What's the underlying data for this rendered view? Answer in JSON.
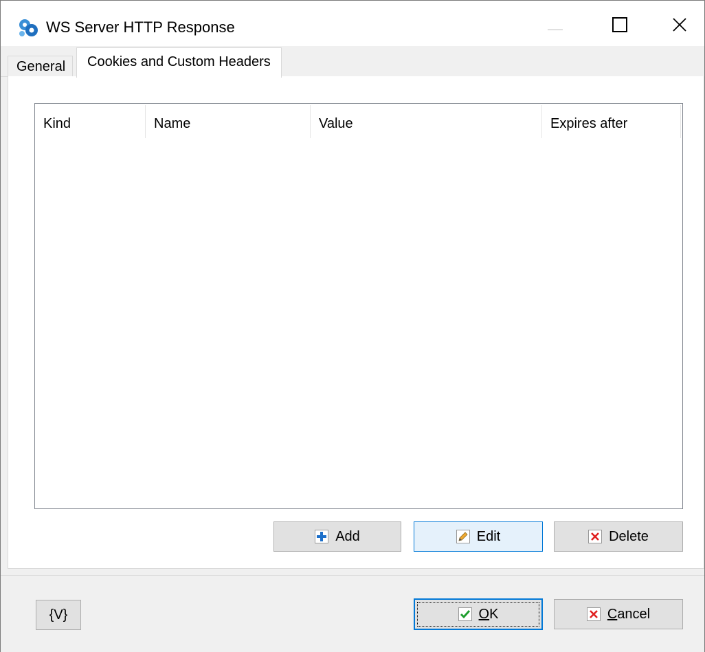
{
  "window": {
    "title": "WS Server HTTP Response",
    "icon": "gears-icon"
  },
  "tabs": [
    {
      "label": "General",
      "active": false
    },
    {
      "label": "Cookies and Custom Headers",
      "active": true
    }
  ],
  "list": {
    "columns": [
      "Kind",
      "Name",
      "Value",
      "Expires after"
    ],
    "rows": []
  },
  "actions": {
    "add_label": "Add",
    "edit_label": "Edit",
    "delete_label": "Delete"
  },
  "footer": {
    "vars_label": "{V}",
    "ok_first": "O",
    "ok_rest": "K",
    "cancel_first": "C",
    "cancel_rest": "ancel"
  },
  "colors": {
    "accent": "#0078d7",
    "add_icon": "#1c6fc9",
    "delete_icon": "#e02020",
    "ok_icon": "#1e9e2e"
  }
}
